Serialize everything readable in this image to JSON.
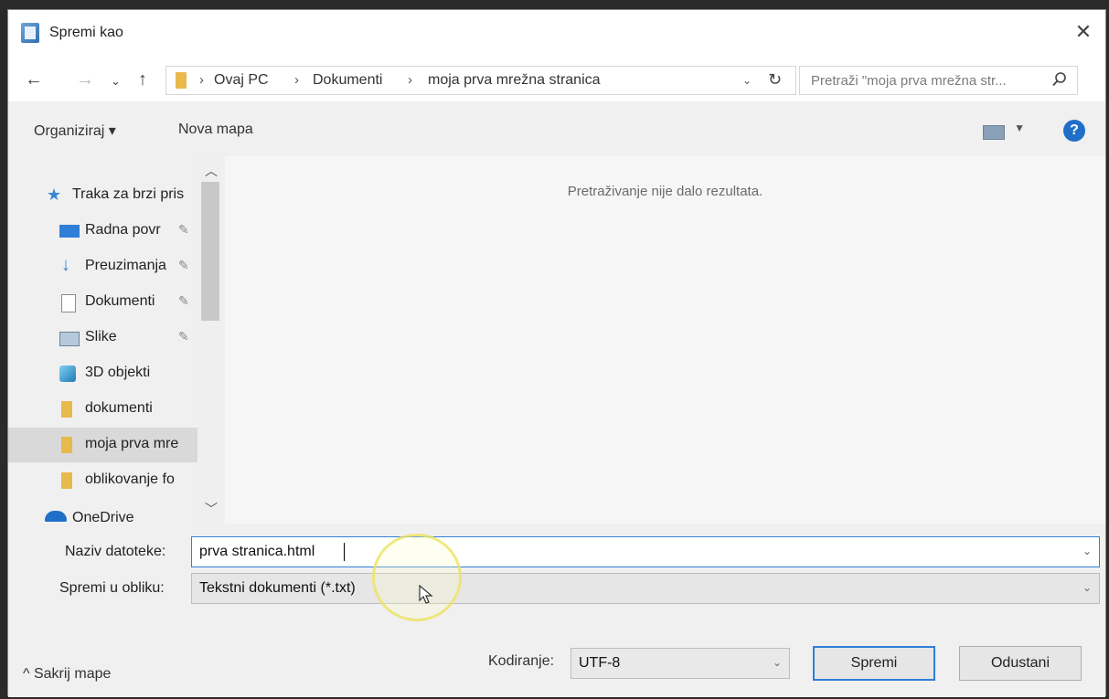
{
  "window": {
    "title": "Spremi kao",
    "close_icon": "close-icon"
  },
  "nav": {
    "breadcrumb": [
      "Ovaj PC",
      "Dokumenti",
      "moja prva mrežna stranica"
    ],
    "search_placeholder": "Pretraži \"moja prva mrežna str..."
  },
  "toolbar": {
    "organize_label": "Organiziraj ▾",
    "new_folder_label": "Nova mapa",
    "help_label": "?"
  },
  "sidebar": {
    "items": [
      {
        "label": "Traka za brzi pris",
        "icon": "star-icon",
        "pinned": false
      },
      {
        "label": "Radna povr",
        "icon": "desktop-icon",
        "pinned": true
      },
      {
        "label": "Preuzimanja",
        "icon": "download-icon",
        "pinned": true
      },
      {
        "label": "Dokumenti",
        "icon": "document-icon",
        "pinned": true
      },
      {
        "label": "Slike",
        "icon": "picture-icon",
        "pinned": true
      },
      {
        "label": "3D objekti",
        "icon": "cube-icon",
        "pinned": false
      },
      {
        "label": "dokumenti",
        "icon": "folder-icon",
        "pinned": false
      },
      {
        "label": "moja prva mre",
        "icon": "folder-icon",
        "pinned": false,
        "selected": true
      },
      {
        "label": "oblikovanje fo",
        "icon": "folder-icon",
        "pinned": false
      },
      {
        "label": "OneDrive",
        "icon": "cloud-icon",
        "pinned": false
      }
    ]
  },
  "content": {
    "empty_message": "Pretraživanje nije dalo rezultata."
  },
  "form": {
    "filename_label": "Naziv datoteke:",
    "filename_value": "prva stranica.html",
    "filetype_label": "Spremi u obliku:",
    "filetype_value": "Tekstni dokumenti (*.txt)",
    "hide_folders_label": "Sakrij mape",
    "encoding_label": "Kodiranje:",
    "encoding_value": "UTF-8",
    "save_label": "Spremi",
    "cancel_label": "Odustani"
  },
  "colors": {
    "accent": "#2f7fd8",
    "folder": "#e8b94b",
    "help": "#1f6fc8"
  }
}
